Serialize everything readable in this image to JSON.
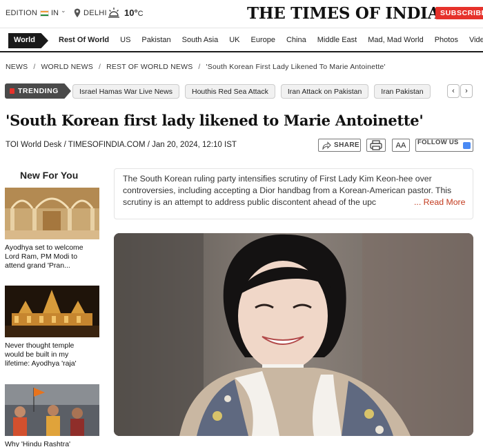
{
  "header": {
    "edition_label": "EDITION",
    "edition_code": "IN",
    "city": "DELHI",
    "temperature": "10°",
    "temperature_unit": "C",
    "logo": "THE TIMES OF INDIA",
    "subscribe": "SUBSCRIBE"
  },
  "nav": {
    "section": "World",
    "items": [
      "Rest Of World",
      "US",
      "Pakistan",
      "South Asia",
      "UK",
      "Europe",
      "China",
      "Middle East",
      "Mad, Mad World",
      "Photos",
      "Videos"
    ]
  },
  "breadcrumb": [
    "NEWS",
    "WORLD NEWS",
    "REST OF WORLD NEWS",
    "'South Korean First Lady Likened To Marie Antoinette'"
  ],
  "trending": {
    "label": "TRENDING",
    "items": [
      "Israel Hamas War Live News",
      "Houthis Red Sea Attack",
      "Iran Attack on Pakistan",
      "Iran Pakistan"
    ]
  },
  "article": {
    "headline": "'South Korean first lady likened to Marie Antoinette'",
    "byline": "TOI World Desk / TIMESOFINDIA.COM / Jan 20, 2024, 12:10 IST",
    "share": "SHARE",
    "font_size_button": "AA",
    "follow": "FOLLOW US",
    "summary": "The South Korean ruling party intensifies scrutiny of First Lady Kim Keon-hee over controversies, including accepting a Dior handbag from a Korean-American pastor. This scrutiny is an attempt to address public discontent ahead of the upc",
    "read_more": "... Read More"
  },
  "sidebar": {
    "title": "New For You",
    "stories": [
      {
        "text": "Ayodhya set to welcome Lord Ram, PM Modi to attend grand 'Pran..."
      },
      {
        "text": "Never thought temple would be built in my lifetime: Ayodhya 'raja'"
      },
      {
        "text": "Why 'Hindu Rashtra'"
      }
    ]
  },
  "colors": {
    "brand_red": "#e6322b",
    "read_more": "#c23a1e",
    "nav_dark": "#1a1a1a"
  }
}
